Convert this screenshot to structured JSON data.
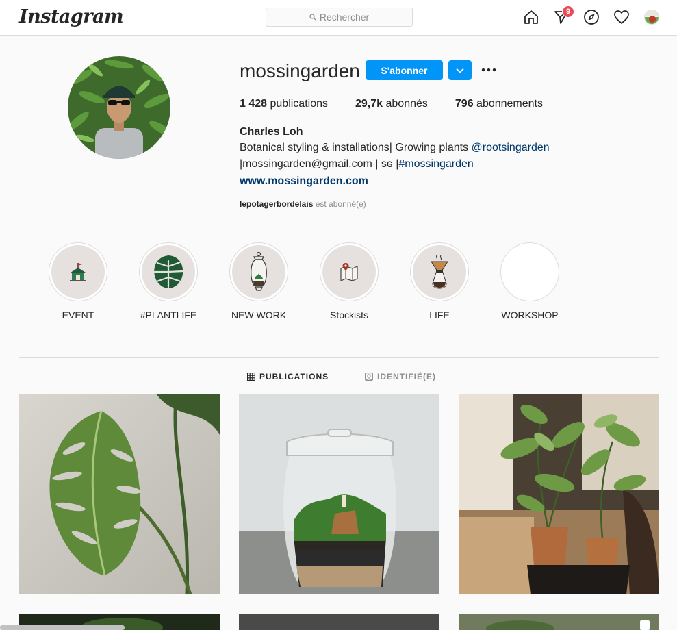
{
  "nav": {
    "logo": "Instagram",
    "search_placeholder": "Rechercher",
    "notification_count": "9"
  },
  "profile": {
    "username": "mossingarden",
    "follow_label": "S'abonner",
    "stats": {
      "posts_count": "1 428",
      "posts_label": " publications",
      "followers_count": "29,7k",
      "followers_label": " abonnés",
      "following_count": "796",
      "following_label": " abonnements"
    },
    "full_name": "Charles Loh",
    "bio_line1_text": "Botanical styling & installations| Growing plants ",
    "bio_line1_mention": "@rootsingarden",
    "bio_line2_text": "|mossingarden@gmail.com | sɢ |",
    "bio_line2_hashtag": "#mossingarden",
    "website": "www.mossingarden.com",
    "followed_by_user": "lepotagerbordelais",
    "followed_by_text": " est abonné(e)"
  },
  "highlights": [
    {
      "label": "EVENT",
      "icon": "tent-icon"
    },
    {
      "label": "#PLANTLIFE",
      "icon": "monstera-leaf-icon"
    },
    {
      "label": "NEW WORK",
      "icon": "terrarium-jar-icon"
    },
    {
      "label": "Stockists",
      "icon": "map-pin-icon"
    },
    {
      "label": "LIFE",
      "icon": "coffee-dripper-icon"
    },
    {
      "label": "WORKSHOP",
      "icon": ""
    }
  ],
  "tabs": [
    {
      "label": "PUBLICATIONS",
      "icon": "grid-icon",
      "active": true
    },
    {
      "label": "IDENTIFIÉ(E)",
      "icon": "tagged-user-icon",
      "active": false
    }
  ],
  "posts": [
    {
      "subject": "monstera-leaf-photo"
    },
    {
      "subject": "terrarium-jar-photo"
    },
    {
      "subject": "potted-plants-photo"
    }
  ],
  "colors": {
    "accent": "#0095f6",
    "link": "#00376b",
    "badge": "#ed4956",
    "text": "#262626",
    "muted": "#8e8e8e",
    "border": "#dbdbdb"
  }
}
